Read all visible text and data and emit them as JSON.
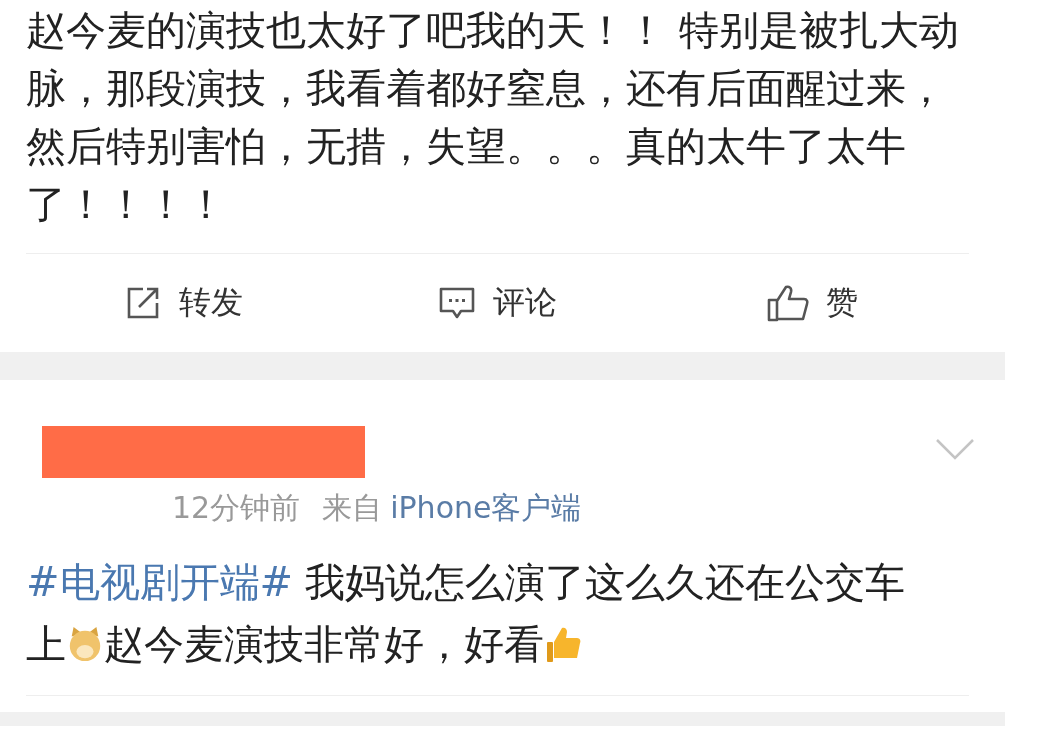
{
  "post": {
    "text": "赵今麦的演技也太好了吧我的天！！ 特别是被扎大动脉，那段演技，我看着都好窒息，还有后面醒过来，然后特别害怕，无措，失望。。。真的太牛了太牛了！！！！",
    "actions": [
      {
        "kind": "share",
        "label": "转发"
      },
      {
        "kind": "comment",
        "label": "评论"
      },
      {
        "kind": "like",
        "label": "赞"
      }
    ]
  },
  "comment": {
    "time": "12分钟前",
    "source_prefix": "来自",
    "source": "iPhone客户端",
    "lines": [
      [
        {
          "kind": "hashtag",
          "text": "#电视剧开端#"
        },
        {
          "kind": "text",
          "text": "我妈说怎么演了这么久还在公交车"
        }
      ],
      [
        {
          "kind": "text",
          "text": "上"
        },
        {
          "kind": "emoji"
        },
        {
          "kind": "text",
          "text": "赵今麦演技非常好，好看"
        },
        {
          "kind": "thumbs"
        }
      ]
    ]
  }
}
